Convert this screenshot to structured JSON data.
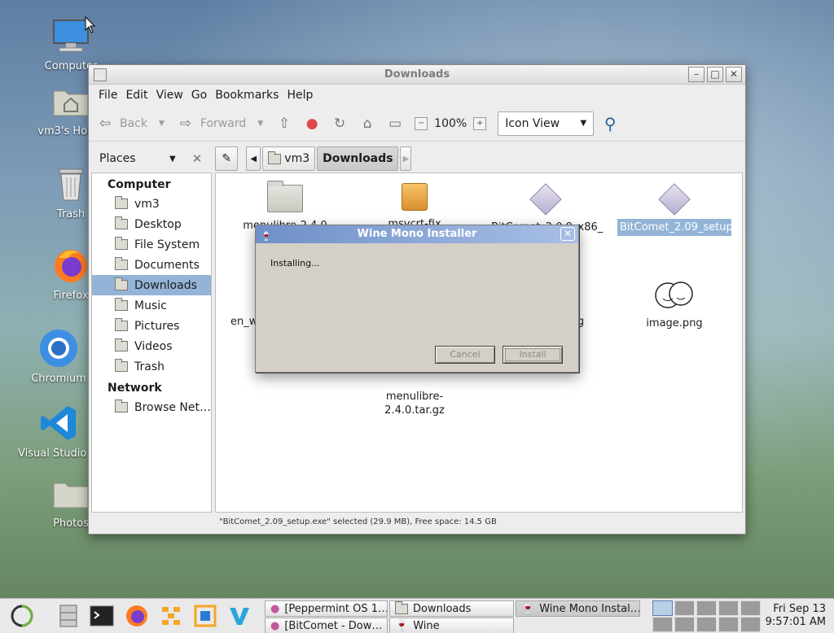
{
  "desktop": {
    "icons": [
      {
        "label": "Computer"
      },
      {
        "label": "vm3's Home"
      },
      {
        "label": "Trash"
      },
      {
        "label": "Firefox"
      },
      {
        "label": "Chromium"
      },
      {
        "label": "Visual Studio Code"
      },
      {
        "label": "Photos"
      }
    ]
  },
  "file_manager": {
    "title": "Downloads",
    "menu": [
      "File",
      "Edit",
      "View",
      "Go",
      "Bookmarks",
      "Help"
    ],
    "toolbar": {
      "back": "Back",
      "forward": "Forward",
      "zoom": "100%",
      "view_mode": "Icon View"
    },
    "places_label": "Places",
    "path": [
      "vm3",
      "Downloads"
    ],
    "sidebar": {
      "computer_header": "Computer",
      "computer_items": [
        "vm3",
        "Desktop",
        "File System",
        "Documents",
        "Downloads",
        "Music",
        "Pictures",
        "Videos",
        "Trash"
      ],
      "network_header": "Network",
      "network_items": [
        "Browse Net…"
      ]
    },
    "files": [
      {
        "name": "menulibre-2.4.0"
      },
      {
        "name": "msvcrt-fix"
      },
      {
        "name": "BitComet_2.0.9_x86_"
      },
      {
        "name": "BitComet_2.09_setup.exe"
      },
      {
        "name": "en_windows_8_x64_dvd_915440.iso"
      },
      {
        "name": ".jpg"
      },
      {
        "name": "image.png"
      },
      {
        "name": "menulibre-2.4.0.tar.gz"
      }
    ],
    "status": "\"BitComet_2.09_setup.exe\" selected (29.9 MB), Free space: 14.5 GB"
  },
  "dialog": {
    "title": "Wine Mono Installer",
    "message": "Installing...",
    "cancel": "Cancel",
    "install": "Install"
  },
  "taskbar": {
    "tasks": [
      "[Peppermint OS 1…",
      "Downloads",
      "Wine Mono Instal…",
      "[BitComet - Dow…",
      "Wine"
    ],
    "clock_day": "Fri Sep 13",
    "clock_time": "9:57:01 AM"
  },
  "colors": {
    "selection": "#93b4d6",
    "dialog_title": "#6e8fc8"
  }
}
